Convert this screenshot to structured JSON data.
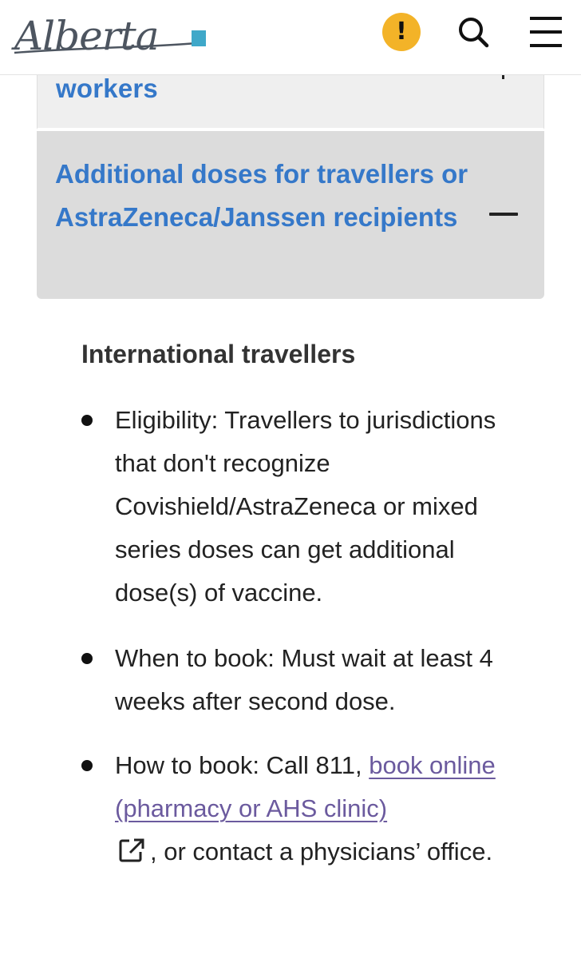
{
  "header": {
    "logo_text": "Alberta",
    "alert_icon": "exclamation-icon",
    "alert_symbol": "!",
    "search_icon": "search-icon",
    "menu_icon": "hamburger-menu-icon"
  },
  "colors": {
    "link_blue": "#3578c9",
    "alert_yellow": "#f3b328",
    "visited_link": "#6b5a9e",
    "accordion_open_bg": "#dcdcdc",
    "accordion_closed_bg": "#efefef"
  },
  "accordion": {
    "previous_item_label": "workers",
    "open_item_title": "Additional doses for travellers or AstraZeneca/Janssen recipients",
    "open_item_state_icon": "minus-icon"
  },
  "content": {
    "heading": "International travellers",
    "items": [
      {
        "text": "Eligibility: Travellers to jurisdictions that don't recognize Covishield/AstraZeneca or mixed series doses can get additional dose(s) of vaccine."
      },
      {
        "text": "When to book: Must wait at least 4 weeks after second dose."
      },
      {
        "prefix": "How to book: Call 811, ",
        "link_text": "book online (pharmacy or AHS clinic)",
        "link_icon": "external-link-icon",
        "suffix": ", or contact a physicians’ office."
      }
    ]
  }
}
